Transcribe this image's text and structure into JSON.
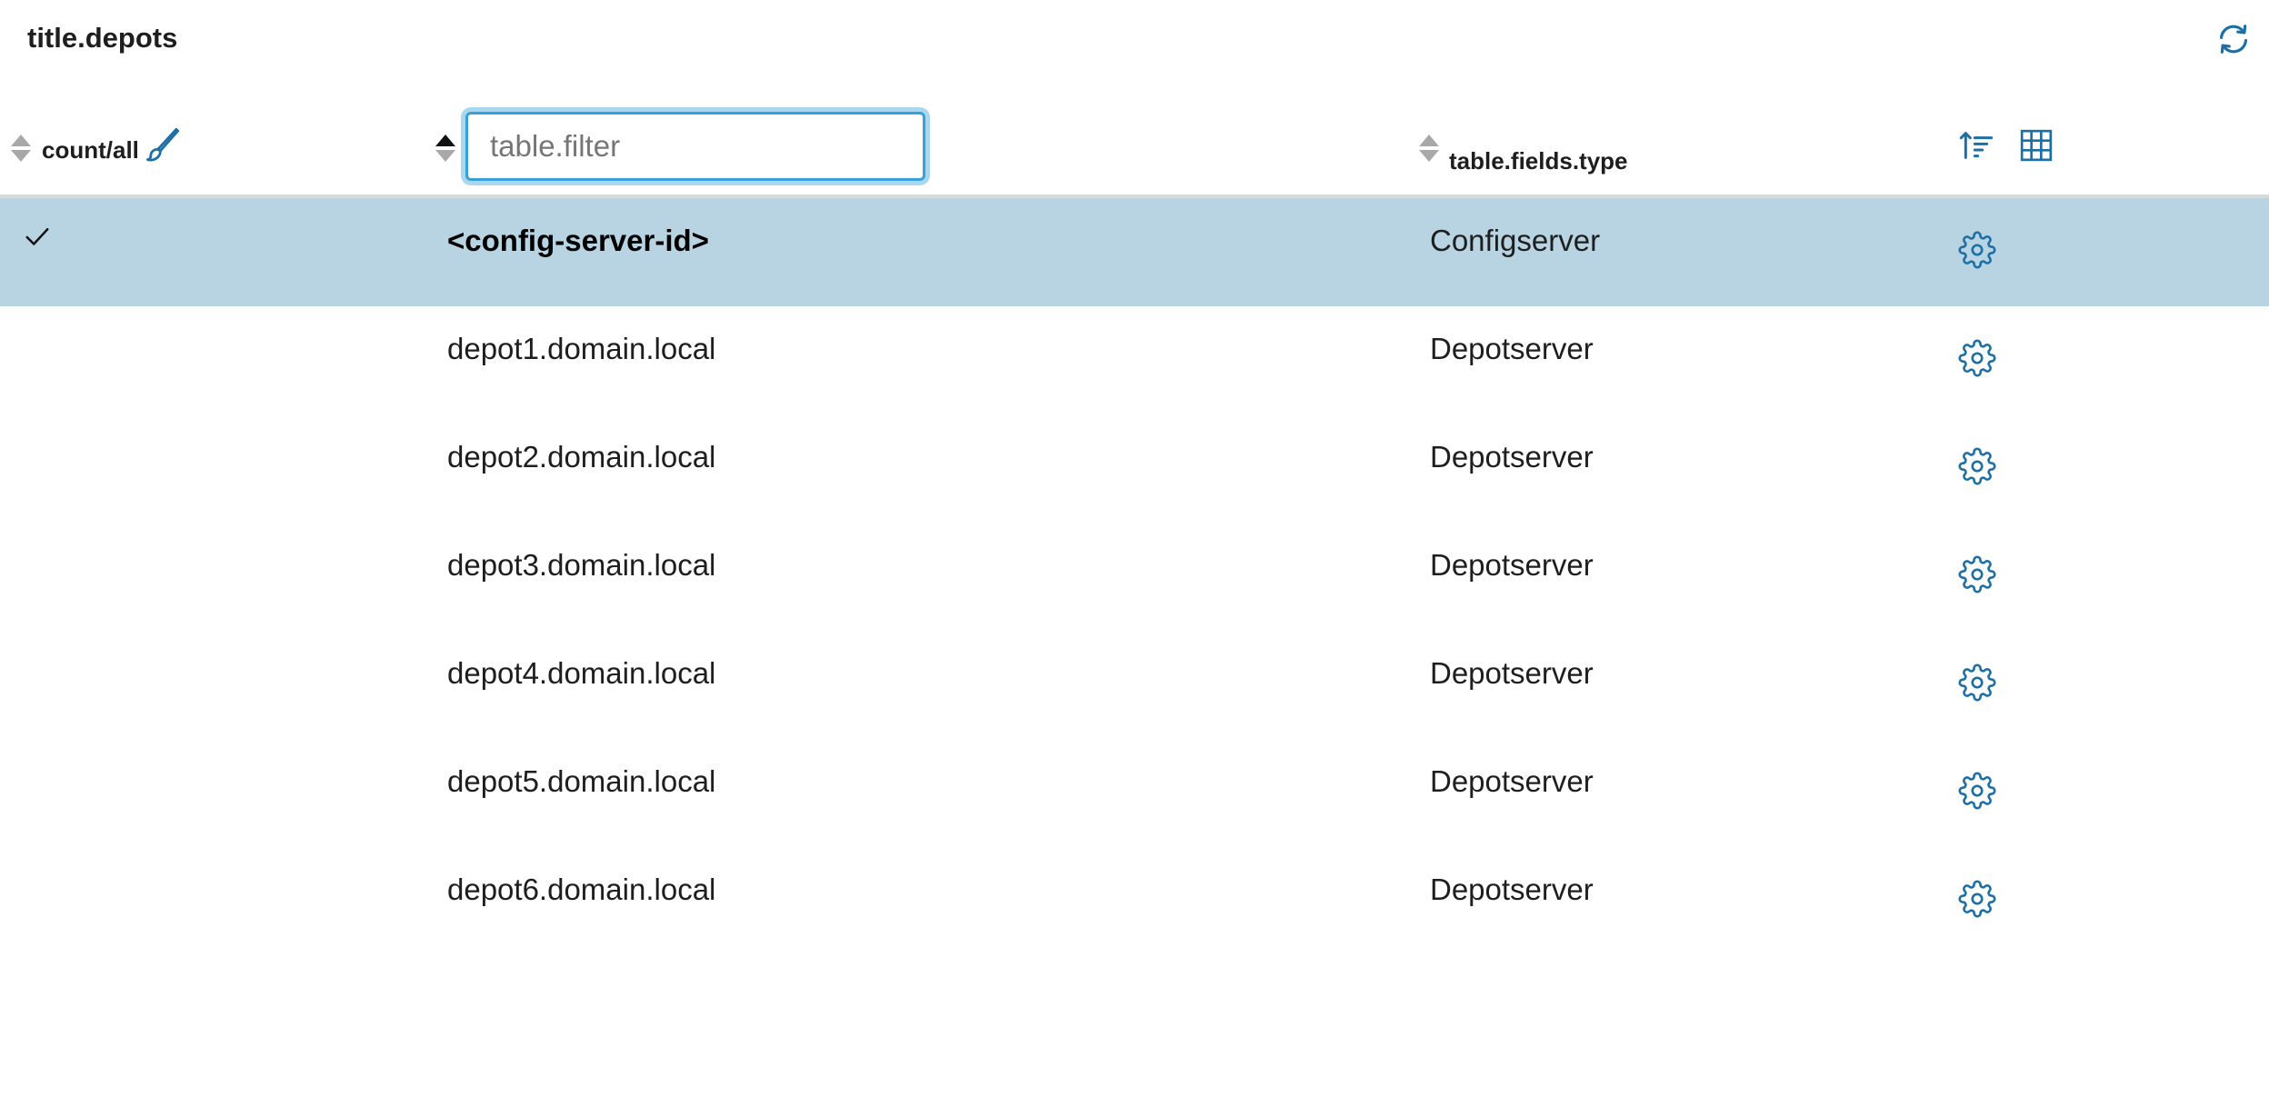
{
  "title": "title.depots",
  "icons": {
    "refresh": "refresh-icon",
    "brush": "brush-icon",
    "sort_menu": "sort-lines-icon",
    "grid": "table-grid-icon",
    "gear": "gear-icon",
    "check": "check-icon"
  },
  "colors": {
    "accent": "#1d6fa5",
    "selected_row": "#b8d4e3",
    "input_border": "#3aa1d8"
  },
  "header": {
    "count_label": "count/all",
    "filter_placeholder": "table.filter",
    "filter_value": "",
    "type_label": "table.fields.type",
    "name_sort": "ascending"
  },
  "rows": [
    {
      "name": "<config-server-id>",
      "type": "Configserver",
      "selected": true
    },
    {
      "name": "depot1.domain.local",
      "type": "Depotserver",
      "selected": false
    },
    {
      "name": "depot2.domain.local",
      "type": "Depotserver",
      "selected": false
    },
    {
      "name": "depot3.domain.local",
      "type": "Depotserver",
      "selected": false
    },
    {
      "name": "depot4.domain.local",
      "type": "Depotserver",
      "selected": false
    },
    {
      "name": "depot5.domain.local",
      "type": "Depotserver",
      "selected": false
    },
    {
      "name": "depot6.domain.local",
      "type": "Depotserver",
      "selected": false
    }
  ]
}
